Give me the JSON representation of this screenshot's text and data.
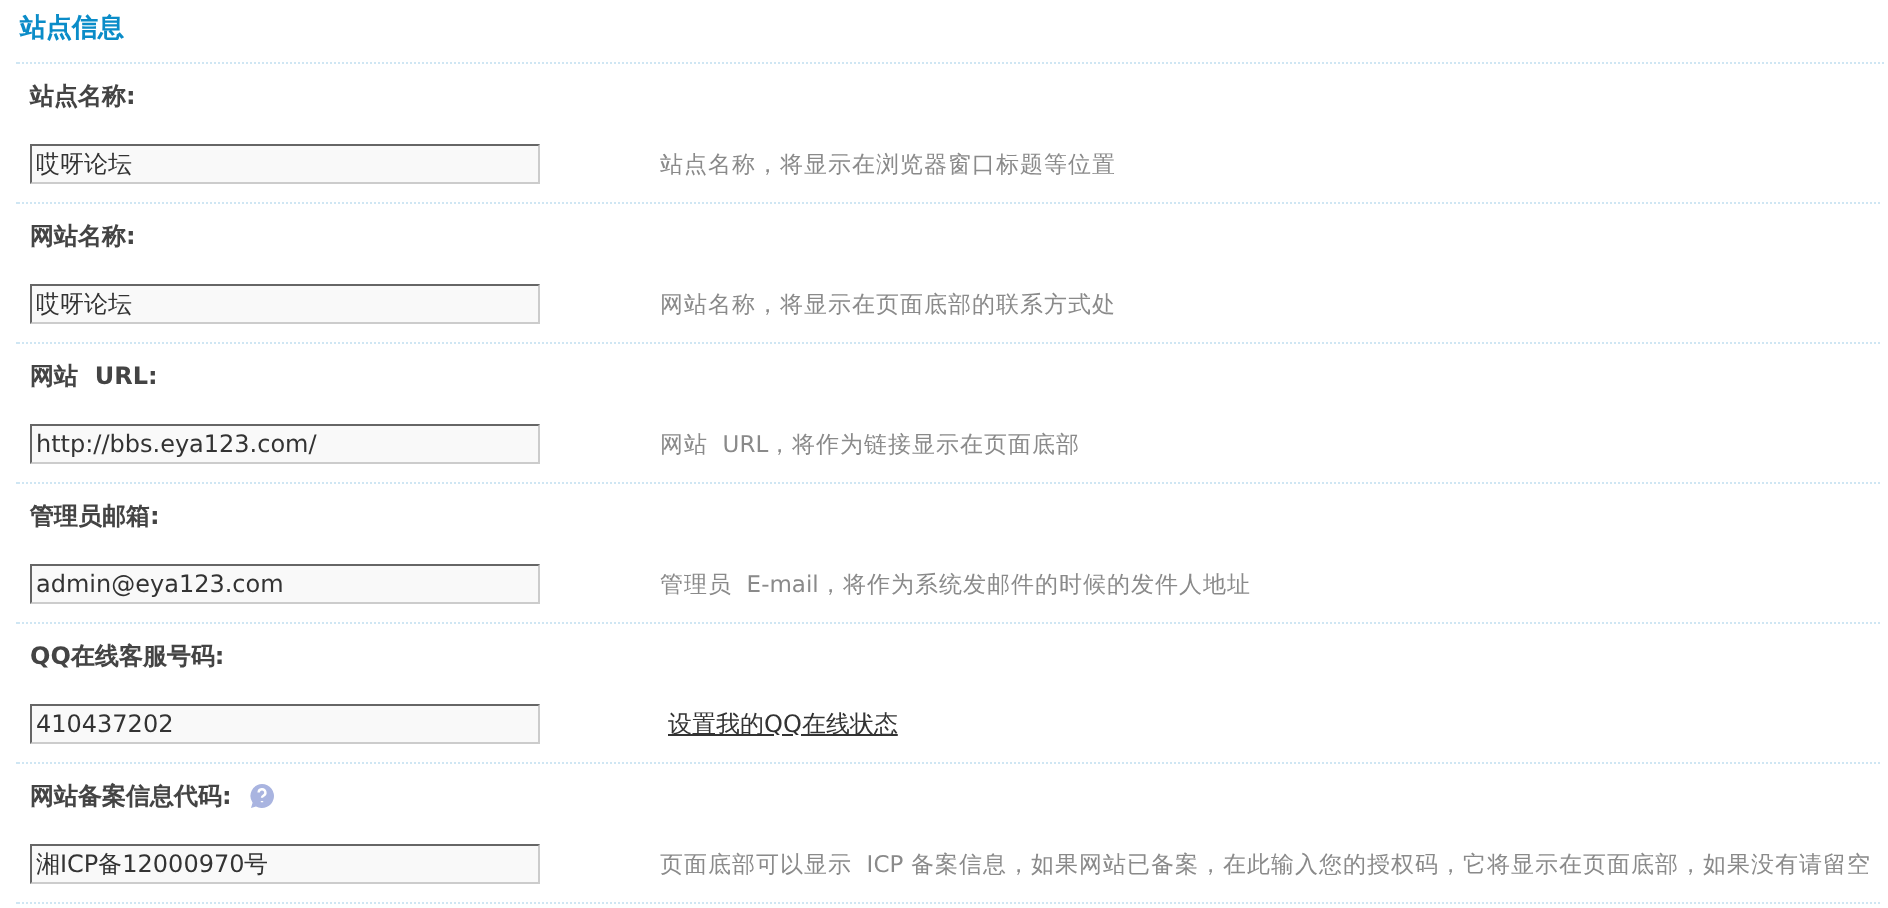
{
  "section_title": "站点信息",
  "fields": [
    {
      "label": "站点名称:",
      "value": "哎呀论坛",
      "kind": "hint",
      "note": "站点名称，将显示在浏览器窗口标题等位置",
      "help": false
    },
    {
      "label": "网站名称:",
      "value": "哎呀论坛",
      "kind": "hint",
      "note": "网站名称，将显示在页面底部的联系方式处",
      "help": false
    },
    {
      "label": "网站  URL:",
      "value": "http://bbs.eya123.com/",
      "kind": "hint",
      "note": "网站  URL，将作为链接显示在页面底部",
      "help": false
    },
    {
      "label": "管理员邮箱:",
      "value": "admin@eya123.com",
      "kind": "hint",
      "note": "管理员  E-mail，将作为系统发邮件的时候的发件人地址",
      "help": false
    },
    {
      "label": "QQ在线客服号码:",
      "value": "410437202",
      "kind": "link",
      "note": "设置我的QQ在线状态",
      "help": false
    },
    {
      "label": "网站备案信息代码:",
      "value": "湘ICP备12000970号",
      "kind": "hint",
      "note": "页面底部可以显示  ICP 备案信息，如果网站已备案，在此输入您的授权码，它将显示在页面底部，如果没有请留空",
      "help": true
    }
  ]
}
